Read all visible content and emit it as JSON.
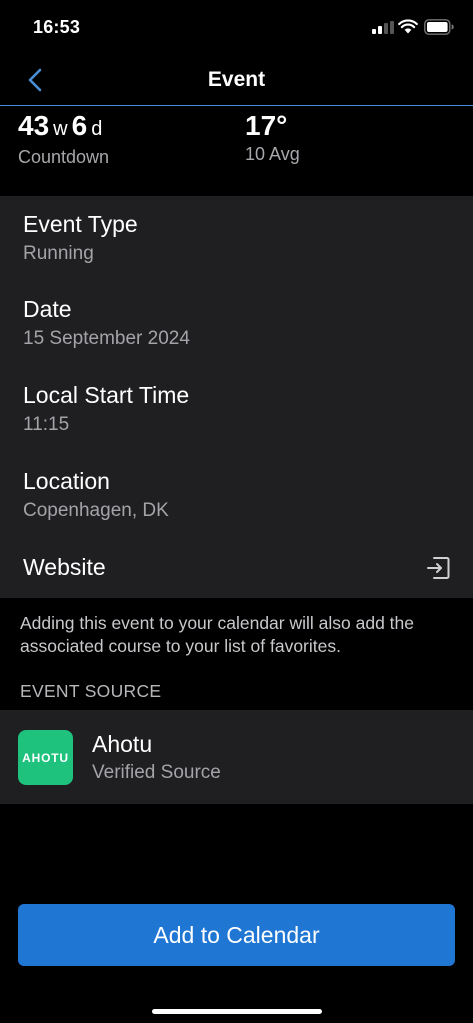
{
  "status_bar": {
    "time": "16:53"
  },
  "nav": {
    "title": "Event"
  },
  "stats": {
    "countdown": {
      "weeks": "43",
      "weeks_unit": "w",
      "days": "6",
      "days_unit": "d",
      "label": "Countdown"
    },
    "temperature": {
      "value": "17°",
      "label": "10 Avg"
    }
  },
  "details": {
    "event_type": {
      "label": "Event Type",
      "value": "Running"
    },
    "date": {
      "label": "Date",
      "value": "15 September 2024"
    },
    "start_time": {
      "label": "Local Start Time",
      "value": "11:15"
    },
    "location": {
      "label": "Location",
      "value": "Copenhagen, DK"
    },
    "website": {
      "label": "Website"
    }
  },
  "notice": "Adding this event to your calendar will also add the associated course to your list of favorites.",
  "event_source": {
    "header": "EVENT SOURCE",
    "logo_text": "AHOTU",
    "name": "Ahotu",
    "subtitle": "Verified Source"
  },
  "add_button_label": "Add to Calendar",
  "colors": {
    "accent": "#1f76d3",
    "nav_divider": "#4a90d9",
    "card_background": "#1f1f21",
    "source_logo": "#1ec27d"
  }
}
